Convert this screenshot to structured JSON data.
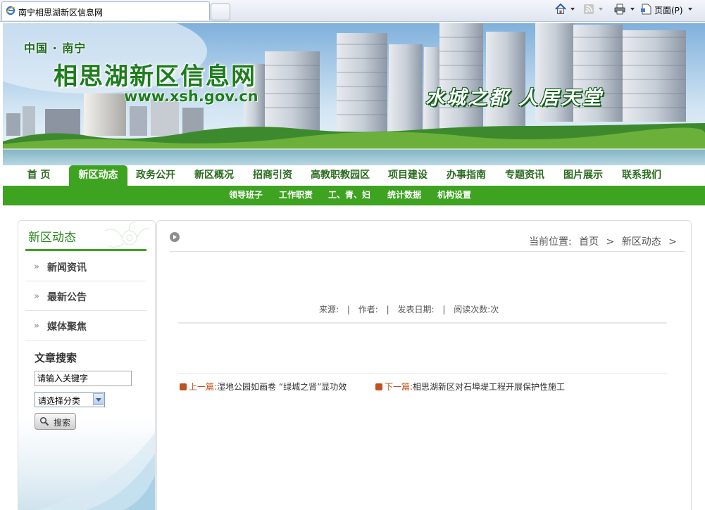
{
  "browser": {
    "tab_title": "南宁相思湖新区信息网",
    "page_menu_label": "页面(P)"
  },
  "banner": {
    "subtitle": "中国 · 南宁",
    "title": "相思湖新区信息网",
    "url": "www.xsh.gov.cn",
    "slogan": "水城之都 人居天堂"
  },
  "nav": {
    "items": [
      "首 页",
      "新区动态",
      "政务公开",
      "新区概况",
      "招商引资",
      "高教职教园区",
      "项目建设",
      "办事指南",
      "专题资讯",
      "图片展示",
      "联系我们"
    ],
    "active": "新区动态",
    "sub_items": [
      "领导班子",
      "工作职责",
      "工、青、妇",
      "统计数据",
      "机构设置"
    ]
  },
  "sidebar": {
    "heading": "新区动态",
    "items": [
      "新闻资讯",
      "最新公告",
      "媒体聚焦"
    ],
    "arrow": "»",
    "search_title": "文章搜索",
    "search_value": "请输入关键字",
    "category_value": "请选择分类",
    "search_button": "搜索"
  },
  "content": {
    "breadcrumb_label": "当前位置:",
    "breadcrumb": [
      "首页",
      ">",
      "新区动态",
      ">"
    ],
    "meta": {
      "source": "来源:",
      "sep1": "|",
      "author": "作者:",
      "sep2": "|",
      "date": "发表日期:",
      "sep3": "|",
      "views": "阅读次数:次"
    },
    "prev_label": "上一篇:",
    "prev_title": "湿地公园如画卷 “绿城之肾”显功效",
    "next_label": "下一篇:",
    "next_title": "相思湖新区对石埠堤工程开展保护性施工"
  },
  "colors": {
    "nav_green": "#3da321",
    "title_green": "#1d7d1d",
    "accent_orange": "#c0511e"
  }
}
